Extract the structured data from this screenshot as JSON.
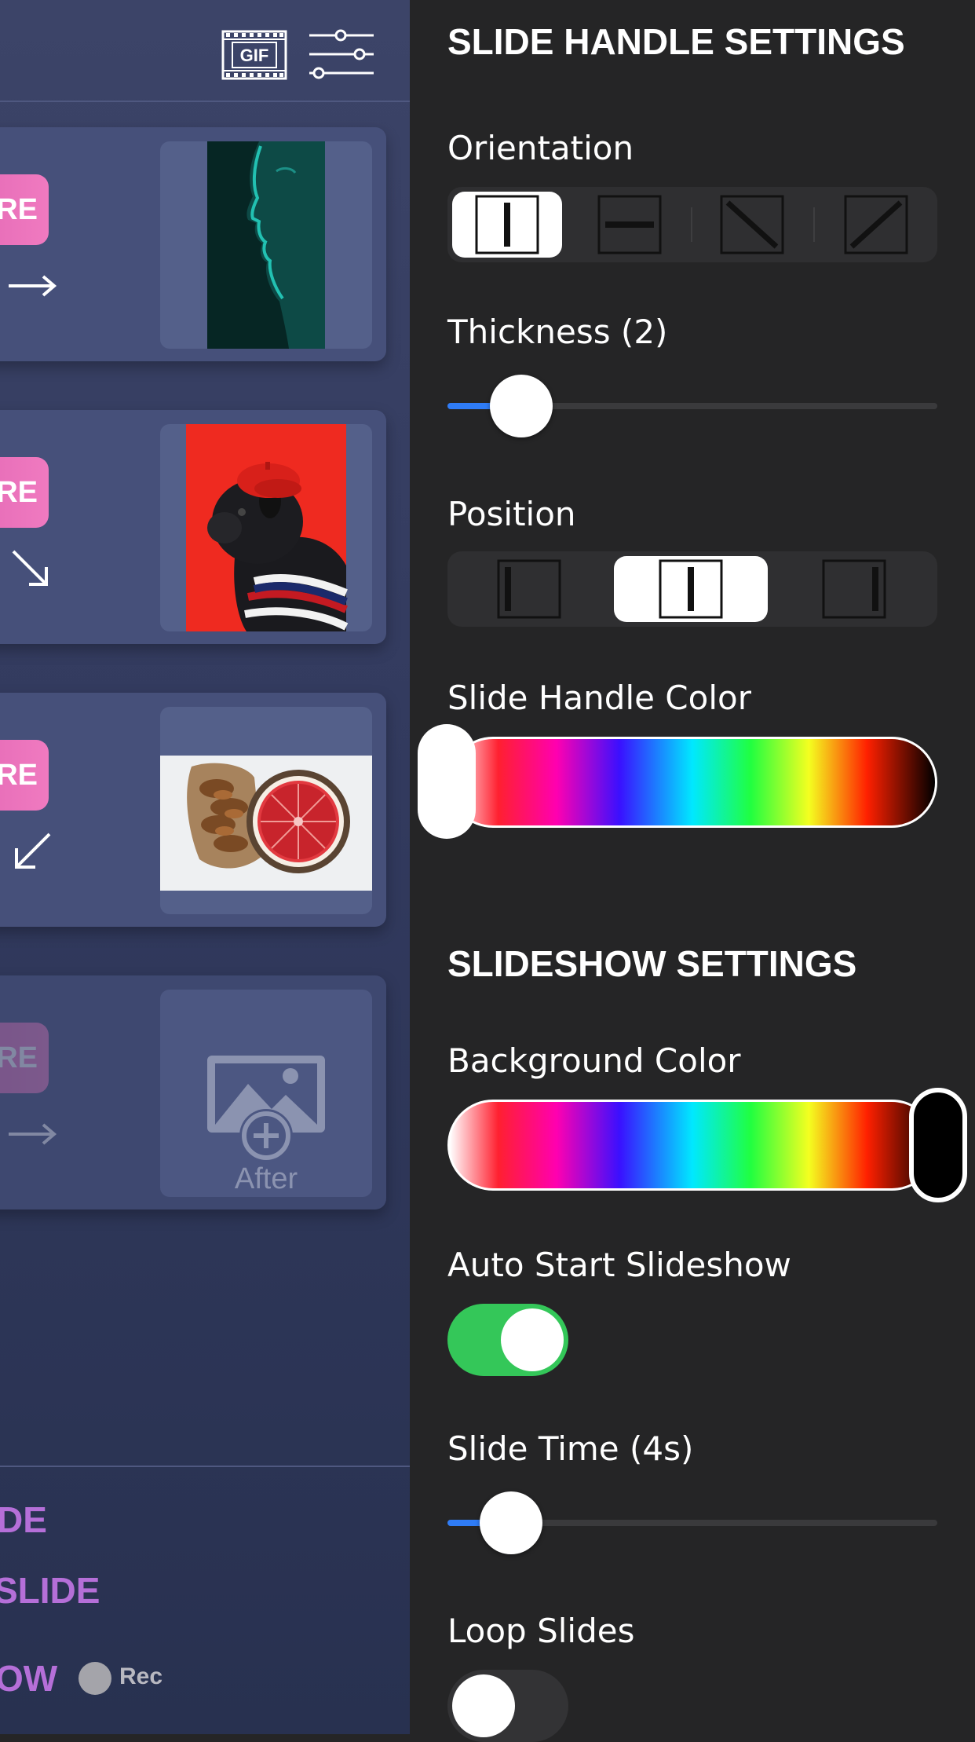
{
  "toolbar": {
    "gif_label": "GIF",
    "gif_icon": "gif-film-icon",
    "settings_icon": "sliders-icon"
  },
  "cards": [
    {
      "pill": "RE",
      "arrow": "→",
      "image": "portrait-teal-face"
    },
    {
      "pill": "RE",
      "arrow": "↘",
      "image": "pug-red-beret"
    },
    {
      "pill": "RE",
      "arrow": "↙",
      "image": "pastry-grapefruit"
    },
    {
      "pill": "RE",
      "arrow": "→",
      "placeholder": "After"
    }
  ],
  "bottom_menu": {
    "item1": "DE",
    "item2": "SLIDE",
    "item3": "OW",
    "rec_label": "Rec"
  },
  "slide_handle_settings": {
    "header": "SLIDE HANDLE SETTINGS",
    "orientation_label": "Orientation",
    "orientation_options": [
      "vertical",
      "horizontal",
      "diagonal-down",
      "diagonal-up"
    ],
    "orientation_selected": "vertical",
    "thickness_label": "Thickness (2)",
    "thickness_value": 2,
    "thickness_fraction": 0.15,
    "position_label": "Position",
    "position_options": [
      "left",
      "center",
      "right"
    ],
    "position_selected": "center",
    "color_label": "Slide Handle Color",
    "color_value": "#ffffff"
  },
  "slideshow_settings": {
    "header": "SLIDESHOW SETTINGS",
    "background_label": "Background Color",
    "background_value": "#000000",
    "auto_start_label": "Auto Start Slideshow",
    "auto_start_on": true,
    "slide_time_label": "Slide Time (4s)",
    "slide_time_fraction": 0.13,
    "loop_label": "Loop Slides",
    "loop_on": false
  },
  "colors": {
    "accent_blue": "#2f7cf6",
    "toggle_on": "#34c759",
    "pill_pink": "#e86cb8",
    "menu_purple": "#b56fd8"
  }
}
